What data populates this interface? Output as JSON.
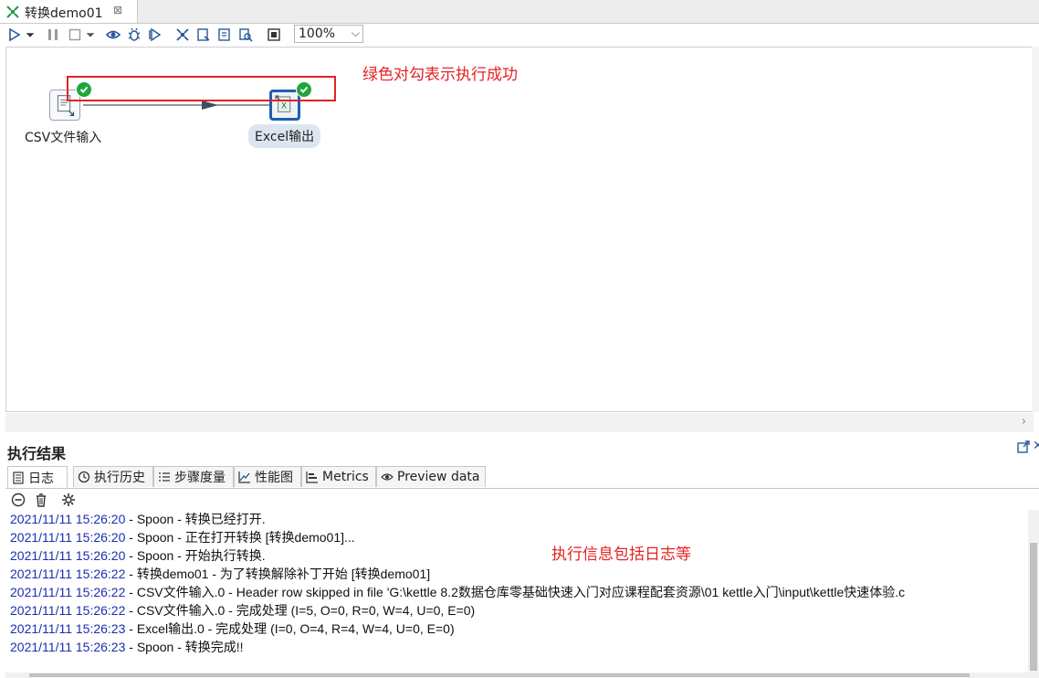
{
  "tab": {
    "title": "转换demo01",
    "close": "⊠"
  },
  "toolbar": {
    "zoom": "100%"
  },
  "canvas": {
    "steps": [
      {
        "label": "CSV文件输入"
      },
      {
        "label": "Excel输出"
      }
    ],
    "annotation": "绿色对勾表示执行成功"
  },
  "results": {
    "title": "执行结果",
    "tabs": [
      "日志",
      "执行历史",
      "步骤度量",
      "性能图",
      "Metrics",
      "Preview data"
    ],
    "annotation": "执行信息包括日志等",
    "log": [
      {
        "ts": "2021/11/11 15:26:20",
        "msg": " - Spoon - 转换已经打开."
      },
      {
        "ts": "2021/11/11 15:26:20",
        "msg": " - Spoon - 正在打开转换 [转换demo01]..."
      },
      {
        "ts": "2021/11/11 15:26:20",
        "msg": " - Spoon - 开始执行转换."
      },
      {
        "ts": "2021/11/11 15:26:22",
        "msg": " - 转换demo01 - 为了转换解除补丁开始  [转换demo01]"
      },
      {
        "ts": "2021/11/11 15:26:22",
        "msg": " - CSV文件输入.0 - Header row skipped in file 'G:\\kettle 8.2数据仓库零基础快速入门对应课程配套资源\\01 kettle入门\\input\\kettle快速体验.c"
      },
      {
        "ts": "2021/11/11 15:26:22",
        "msg": " - CSV文件输入.0 - 完成处理 (I=5, O=0, R=0, W=4, U=0, E=0)"
      },
      {
        "ts": "2021/11/11 15:26:23",
        "msg": " - Excel输出.0 - 完成处理 (I=0, O=4, R=4, W=4, U=0, E=0)"
      },
      {
        "ts": "2021/11/11 15:26:23",
        "msg": " - Spoon - 转换完成!!"
      }
    ]
  },
  "colors": {
    "success": "#1fa63a",
    "annotation": "#e52222",
    "timestamp": "#1a2fb0",
    "selected": "#1f5fb0"
  }
}
